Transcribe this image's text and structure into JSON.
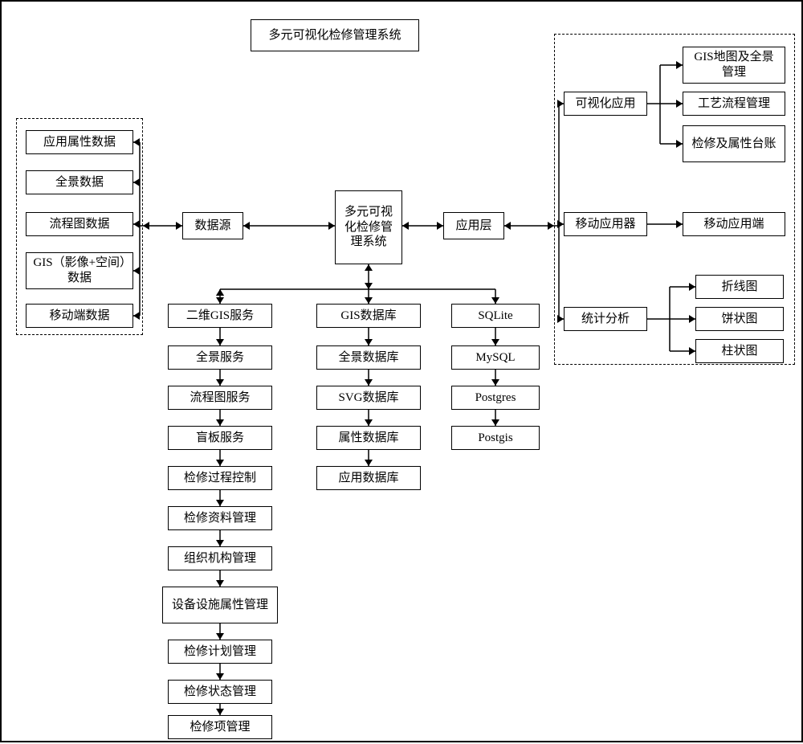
{
  "title": "多元可视化检修管理系统",
  "core": "多元可视化检修管理系统",
  "data_source_label": "数据源",
  "app_layer_label": "应用层",
  "data_source_items": [
    "应用属性数据",
    "全景数据",
    "流程图数据",
    "GIS（影像+空间）数据",
    "移动端数据"
  ],
  "col1_label": "二维GIS服务",
  "col1_items": [
    "全景服务",
    "流程图服务",
    "盲板服务",
    "检修过程控制",
    "检修资料管理",
    "组织机构管理",
    "设备设施属性管理",
    "检修计划管理",
    "检修状态管理",
    "检修项管理"
  ],
  "col2_label": "GIS数据库",
  "col2_items": [
    "全景数据库",
    "SVG数据库",
    "属性数据库",
    "应用数据库"
  ],
  "col3_label": "SQLite",
  "col3_items": [
    "MySQL",
    "Postgres",
    "Postgis"
  ],
  "app_groups": {
    "visual": {
      "label": "可视化应用",
      "items": [
        "GIS地图及全景管理",
        "工艺流程管理",
        "检修及属性台账"
      ]
    },
    "mobile": {
      "label": "移动应用器",
      "child": "移动应用端"
    },
    "stats": {
      "label": "统计分析",
      "items": [
        "折线图",
        "饼状图",
        "柱状图"
      ]
    }
  }
}
